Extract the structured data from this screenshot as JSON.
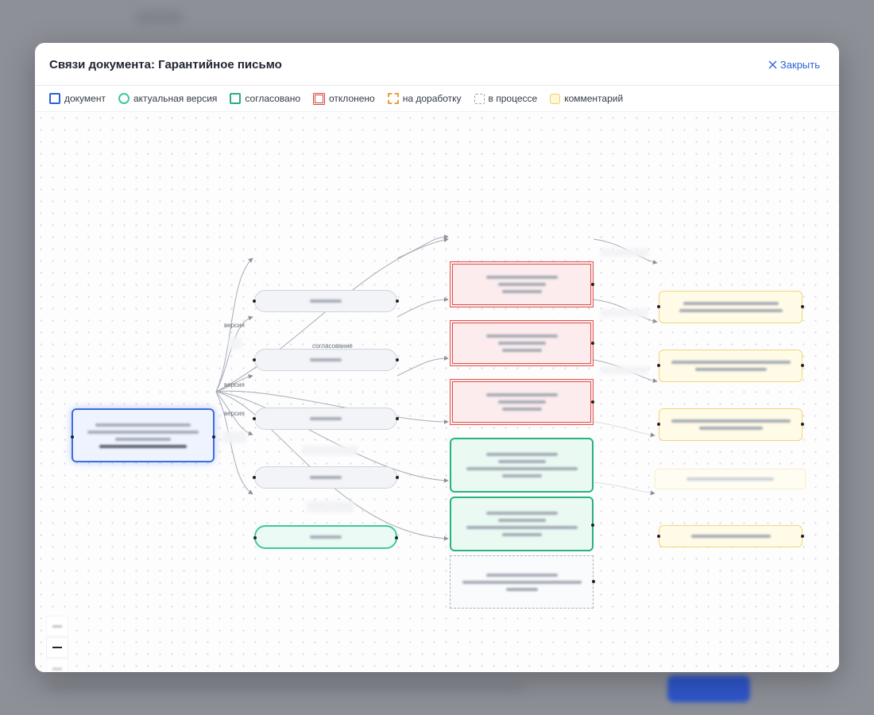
{
  "modal": {
    "title": "Связи документа: Гарантийное письмо",
    "close_label": "Закрыть"
  },
  "legend": [
    {
      "label": "документ",
      "style": "doc"
    },
    {
      "label": "актуальная версия",
      "style": "actual"
    },
    {
      "label": "согласовано",
      "style": "approved"
    },
    {
      "label": "отклонено",
      "style": "rejected"
    },
    {
      "label": "на доработку",
      "style": "revision"
    },
    {
      "label": "в процессе",
      "style": "process"
    },
    {
      "label": "комментарий",
      "style": "comment"
    }
  ],
  "graph": {
    "edge_labels": {
      "version_1": "версия",
      "version_2": "версия",
      "version_3": "версия",
      "approval": "согласование"
    }
  },
  "colors": {
    "accent": "#2c63d8",
    "document": "#2d5fd3",
    "actual_version": "#3ec99a",
    "approved": "#27b37b",
    "rejected": "#e0514c",
    "revision": "#e8a13a",
    "comment": "#f0d67d"
  },
  "zoom_controls": [
    "zoom-in-icon",
    "zoom-out-icon",
    "fit-view-icon",
    "lock-icon"
  ]
}
